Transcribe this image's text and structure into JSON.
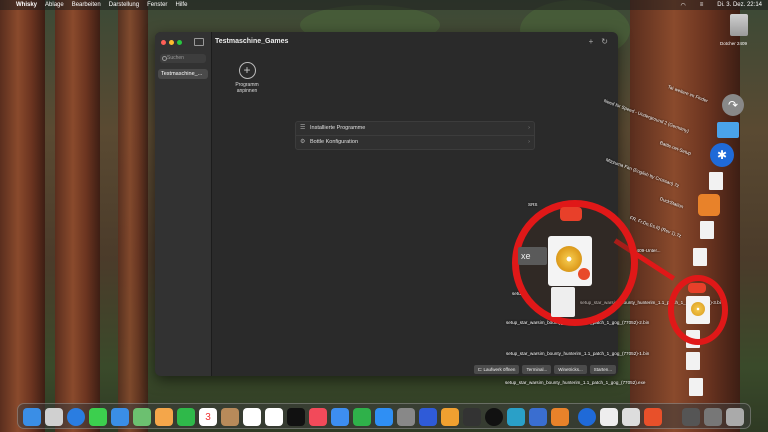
{
  "menubar": {
    "apple_icon": "apple-icon",
    "app_name": "Whisky",
    "menus": [
      "Ablage",
      "Bearbeiten",
      "Darstellung",
      "Fenster",
      "Hilfe"
    ],
    "datetime": "Di. 3. Dez.  22:14"
  },
  "window": {
    "title": "Testmaschine_Games",
    "search_placeholder": "Suchen",
    "sidebar_items": [
      "Testmaschine_..."
    ],
    "pin_label_line1": "Programm",
    "pin_label_line2": "anpinnen",
    "list_rows": [
      {
        "icon": "list-icon",
        "label": "Installierte Programme"
      },
      {
        "icon": "gear-icon",
        "label": "Bottle Konfiguration"
      }
    ],
    "bottom_buttons": [
      "C: Laufwerk öffnen",
      "Terminal...",
      "Winetricks...",
      "Starten..."
    ]
  },
  "desktop": {
    "disk_label": "Dotcher 2409",
    "labels_rotated": [
      "Tai weitere im Finder",
      "Need for Speed - Underground 2 (Germany)",
      "Battle.net-Setup",
      "Mizzuma Fan (English by Crossan) 7z",
      "DuckStation",
      "FR, Fr,De,Es,It) (Rev 1).7z",
      "SRS",
      "2409-Unter...",
      "Whisk..."
    ],
    "labels_flat": [
      "setup_star_warsim_bounty_hunterim_1.1_patch_1_gog_(77052)-3.bi",
      "setup_star_warsim_bounty_hunterim_1.1_patch_1_gog_(77052)-2.bin",
      "setup_star_warsim_bounty_hunterim_1.1_patch_1_gog_(77052)-1.bin",
      "setup_star_warsim_bounty_hunterim_1.1_patch_1_gog_(77052).exe"
    ],
    "zoom_xe": "xe",
    "label_setu": "setu"
  },
  "dock": {
    "items": [
      "finder-icon",
      "launchpad-icon",
      "safari-icon",
      "messages-icon",
      "mail-icon",
      "maps-icon",
      "photos-icon",
      "facetime-icon",
      "calendar-icon",
      "contacts-icon",
      "reminders-icon",
      "freeform-icon",
      "tv-icon",
      "music-icon",
      "keynote-icon",
      "numbers-icon",
      "appstore-icon",
      "settings-icon",
      "box-icon",
      "pages-icon",
      "cursor-icon",
      "xbox-icon",
      "app-icon",
      "network-icon",
      "dragon-icon",
      "bluetooth-icon",
      "textedit-icon",
      "preview-icon",
      "whisky-icon",
      "downloads-icon",
      "display-icon",
      "trash-icon"
    ],
    "calendar_day": "3"
  }
}
